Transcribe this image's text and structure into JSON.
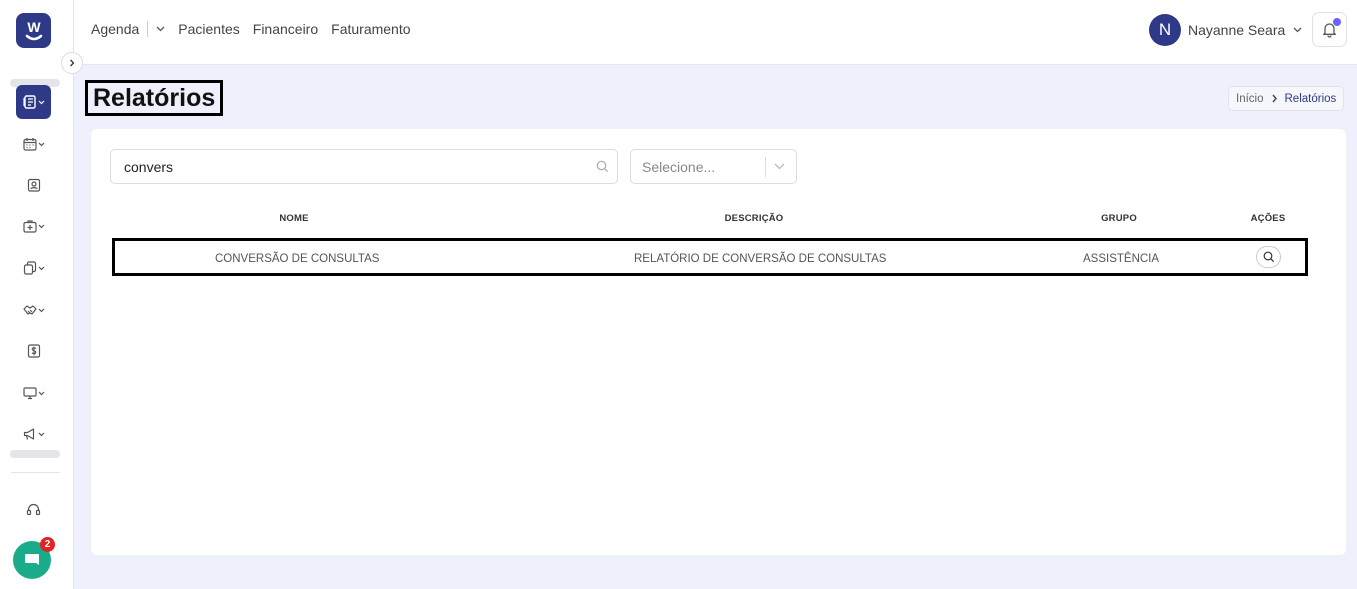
{
  "brand": {
    "logo_letter": "W",
    "accent": "#2e3a87"
  },
  "topnav": {
    "items": [
      "Agenda",
      "Pacientes",
      "Financeiro",
      "Faturamento"
    ]
  },
  "user": {
    "initial": "N",
    "name": "Nayanne Seara"
  },
  "sidebar": {
    "items": [
      {
        "icon": "report-book-icon",
        "active": true,
        "has_caret": true
      },
      {
        "icon": "calendar-icon",
        "has_caret": true
      },
      {
        "icon": "contact-card-icon",
        "has_caret": false
      },
      {
        "icon": "medical-bag-icon",
        "has_caret": true
      },
      {
        "icon": "documents-icon",
        "has_caret": true
      },
      {
        "icon": "handshake-icon",
        "has_caret": true
      },
      {
        "icon": "dollar-icon",
        "has_caret": false
      },
      {
        "icon": "monitor-icon",
        "has_caret": true
      },
      {
        "icon": "megaphone-icon",
        "has_caret": true
      }
    ],
    "support_icon": "headset-icon",
    "chat_badge": "2"
  },
  "page": {
    "title": "Relatórios",
    "breadcrumb": {
      "home": "Início",
      "current": "Relatórios"
    }
  },
  "filters": {
    "search_value": "convers",
    "select_placeholder": "Selecione..."
  },
  "table": {
    "headers": {
      "nome": "NOME",
      "descricao": "DESCRIÇÃO",
      "grupo": "GRUPO",
      "acoes": "AÇÕES"
    },
    "rows": [
      {
        "nome": "CONVERSÃO DE CONSULTAS",
        "descricao": "RELATÓRIO DE CONVERSÃO DE CONSULTAS",
        "grupo": "ASSISTÊNCIA"
      }
    ]
  }
}
